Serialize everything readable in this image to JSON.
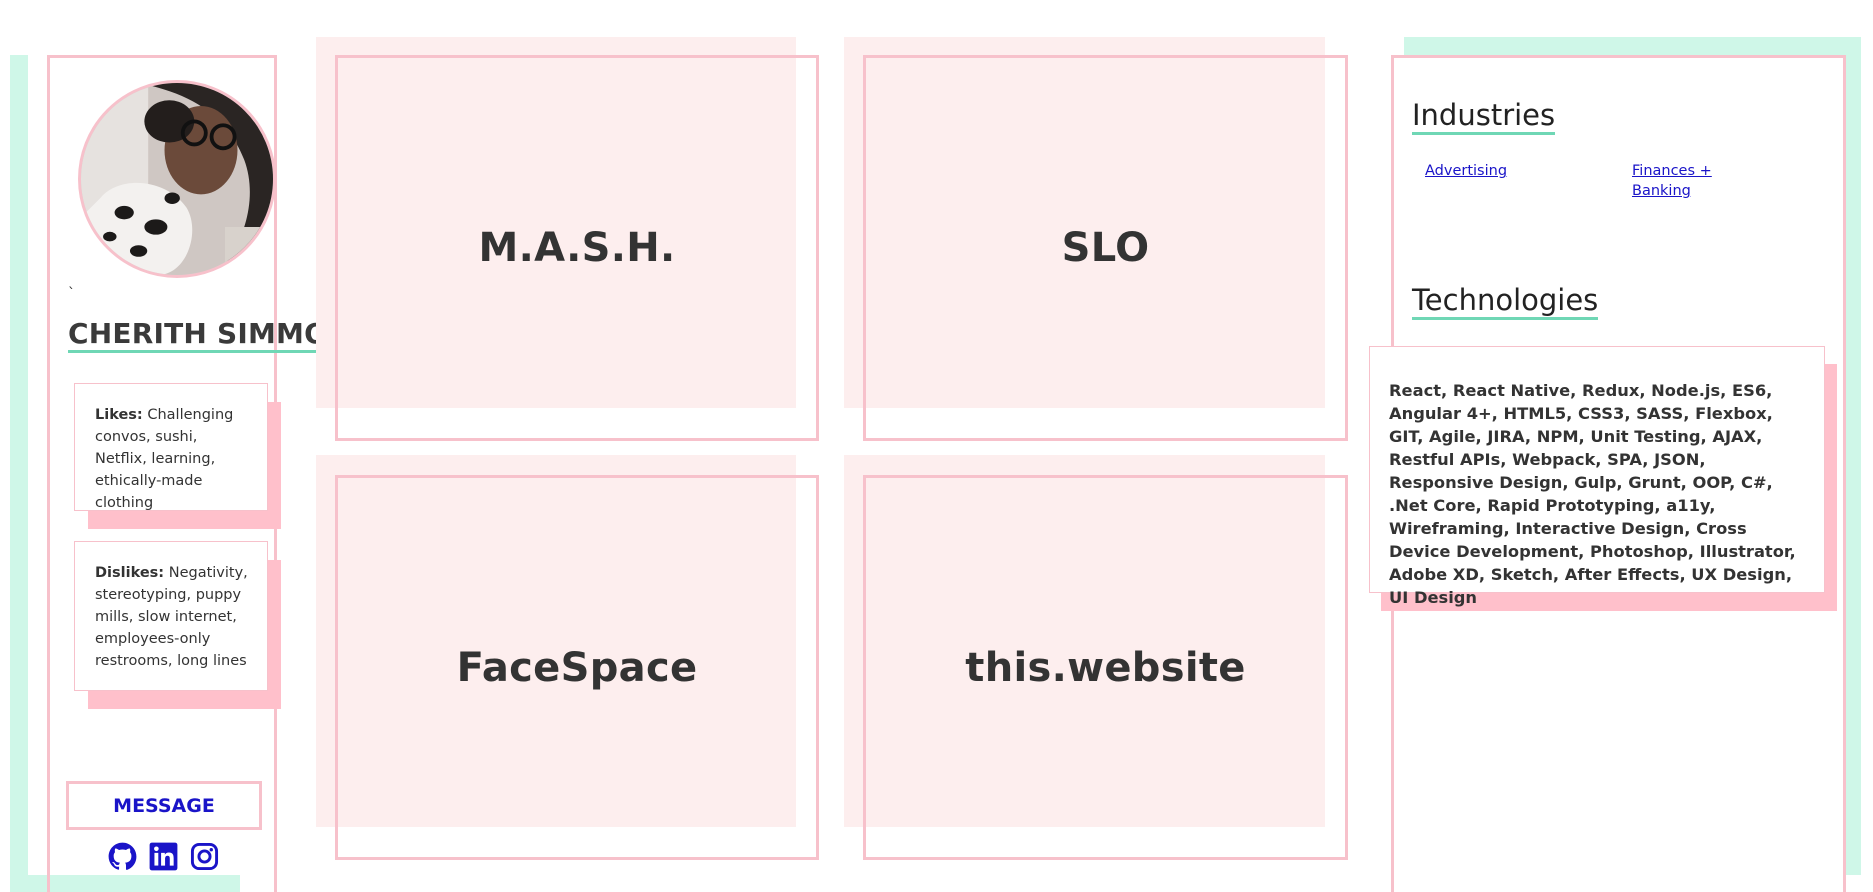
{
  "profile": {
    "avatar_alt": "Cherith Simmons with dog",
    "backtick": "`",
    "name": "CHERITH SIMMONS",
    "likes_label": "Likes:",
    "likes_text": "Challenging convos, sushi, Netflix, learning, ethically-made clothing",
    "dislikes_label": "Dislikes:",
    "dislikes_text": "Negativity, stereotyping, puppy mills, slow internet, employees-only restrooms, long lines",
    "message_label": "MESSAGE",
    "social_icons": [
      "github-icon",
      "linkedin-icon",
      "instagram-icon"
    ]
  },
  "projects": [
    {
      "title": "M.A.S.H."
    },
    {
      "title": "SLO"
    },
    {
      "title": "FaceSpace"
    },
    {
      "title": "this.website"
    }
  ],
  "industries": {
    "heading": "Industries",
    "items": [
      "Advertising",
      "Finances + Banking"
    ]
  },
  "technologies": {
    "heading": "Technologies",
    "text": "React, React Native, Redux, Node.js, ES6, Angular 4+, HTML5, CSS3, SASS, Flexbox, GIT, Agile, JIRA, NPM, Unit Testing, AJAX, Restful APIs, Webpack, SPA, JSON, Responsive Design, Gulp, Grunt, OOP, C#, .Net Core, Rapid Prototyping, a11y, Wireframing, Interactive Design, Cross Device Development, Photoshop, Illustrator, Adobe XD, Sketch, After Effects, UX Design, UI Design"
  },
  "colors": {
    "pink": "#f7c1cb",
    "pink_fill": "#fdeeee",
    "mint": "#cff7e8",
    "mint_underline": "#6fd7b5",
    "link_blue": "#1a14c8",
    "text": "#333333"
  }
}
